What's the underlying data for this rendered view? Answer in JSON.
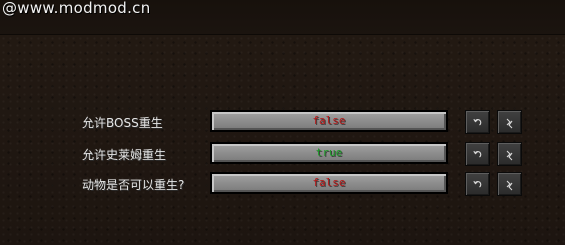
{
  "watermark": "@www.modmod.cn",
  "options": [
    {
      "label": "允许BOSS重生",
      "value": "false",
      "value_color": "#b81a1a"
    },
    {
      "label": "允许史莱姆重生",
      "value": "true",
      "value_color": "#1f9a2a"
    },
    {
      "label": "动物是否可以重生?",
      "value": "false",
      "value_color": "#b81a1a"
    }
  ],
  "icons": {
    "undo": "undo-icon",
    "reset": "reset-icon"
  }
}
